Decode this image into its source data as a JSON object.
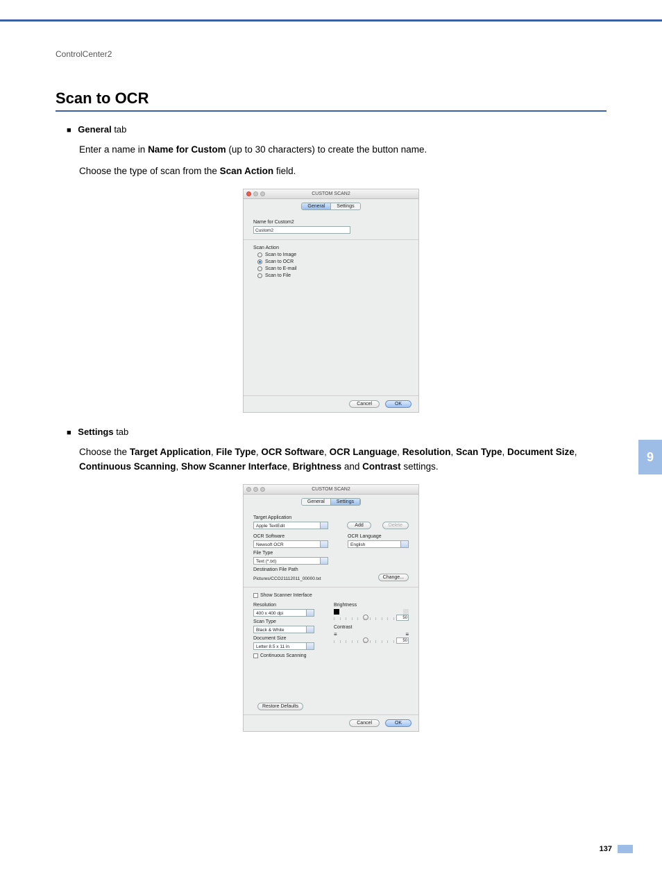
{
  "breadcrumb": "ControlCenter2",
  "heading": "Scan to OCR",
  "section1": {
    "bullet_bold": "General",
    "bullet_rest": " tab",
    "line1_a": "Enter a name in ",
    "line1_b": "Name for Custom",
    "line1_c": " (up to 30 characters) to create the button name.",
    "line2_a": "Choose the type of scan from the ",
    "line2_b": "Scan Action",
    "line2_c": " field."
  },
  "dialog1": {
    "title": "CUSTOM SCAN2",
    "tabs": {
      "general": "General",
      "settings": "Settings"
    },
    "name_label": "Name for Custom2",
    "name_value": "Custom2",
    "scan_action_label": "Scan Action",
    "options": {
      "image": "Scan to Image",
      "ocr": "Scan to OCR",
      "email": "Scan to E-mail",
      "file": "Scan to File"
    },
    "cancel": "Cancel",
    "ok": "OK"
  },
  "section2": {
    "bullet_bold": "Settings",
    "bullet_rest": " tab",
    "line_a": "Choose the ",
    "terms": {
      "t1": "Target Application",
      "c1": ", ",
      "t2": "File Type",
      "c2": ", ",
      "t3": "OCR Software",
      "c3": ", ",
      "t4": "OCR Language",
      "c4": ", ",
      "t5": "Resolution",
      "c5": ", ",
      "t6": "Scan Type",
      "c6": ", ",
      "t7": "Document Size",
      "c7": ", ",
      "t8": "Continuous Scanning",
      "c8": ", ",
      "t9": "Show Scanner Interface",
      "c9": ", ",
      "t10": "Brightness",
      "c10": " and ",
      "t11": "Contrast"
    },
    "line_end": " settings."
  },
  "dialog2": {
    "title": "CUSTOM SCAN2",
    "tabs": {
      "general": "General",
      "settings": "Settings"
    },
    "target_app_label": "Target Application",
    "target_app_value": "Apple TextEdit",
    "add": "Add",
    "delete": "Delete",
    "ocr_sw_label": "OCR Software",
    "ocr_sw_value": "Newsoft OCR",
    "ocr_lang_label": "OCR Language",
    "ocr_lang_value": "English",
    "file_type_label": "File Type",
    "file_type_value": "Text (*.txt)",
    "dest_path_label": "Destination File Path",
    "dest_path_value": "Pictures/CCO21112011_00000.txt",
    "change": "Change...",
    "show_scanner": "Show Scanner Interface",
    "resolution_label": "Resolution",
    "resolution_value": "400 x 400 dpi",
    "scan_type_label": "Scan Type",
    "scan_type_value": "Black & White",
    "doc_size_label": "Document Size",
    "doc_size_value": "Letter 8.5 x 11 in",
    "continuous": "Continuous Scanning",
    "brightness_label": "Brightness",
    "brightness_value": "50",
    "contrast_label": "Contrast",
    "contrast_value": "50",
    "restore": "Restore Defaults",
    "cancel": "Cancel",
    "ok": "OK"
  },
  "chapter": "9",
  "page_number": "137"
}
